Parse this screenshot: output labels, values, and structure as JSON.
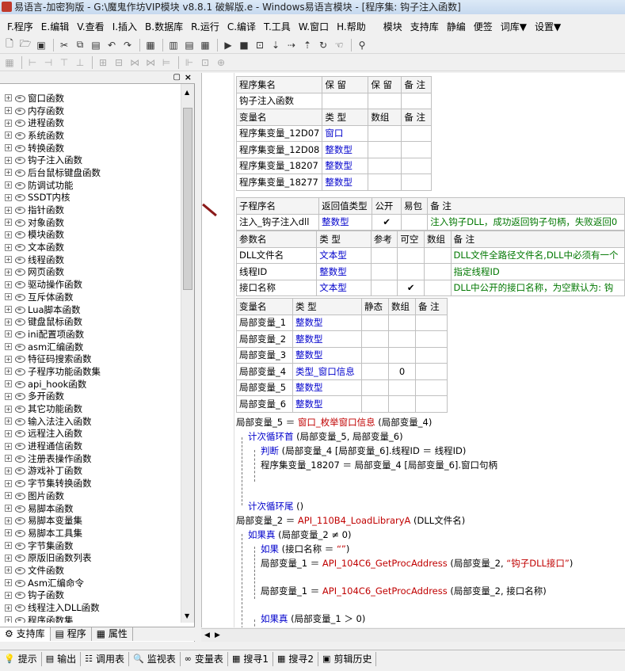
{
  "window": {
    "title": "易语言-加密狗版 - G:\\魔鬼作坊VIP模块 v8.8.1 破解版.e - Windows易语言模块 - [程序集: 钩子注入函数]"
  },
  "menu": [
    "F.程序",
    "E.编辑",
    "V.查看",
    "I.插入",
    "B.数据库",
    "R.运行",
    "C.编译",
    "T.工具",
    "W.窗口",
    "H.帮助",
    "模块",
    "支持库",
    "静编",
    "便签",
    "词库▼",
    "设置▼"
  ],
  "tree": {
    "items": [
      "窗口函数",
      "内存函数",
      "进程函数",
      "系统函数",
      "转换函数",
      "钩子注入函数",
      "后台鼠标键盘函数",
      "防调试功能",
      "SSDT内核",
      "指针函数",
      "对象函数",
      "模块函数",
      "文本函数",
      "线程函数",
      "网页函数",
      "驱动操作函数",
      "互斥体函数",
      "Lua脚本函数",
      "键盘鼠标函数",
      "ini配置项函数",
      "asm汇编函数",
      "特征码搜索函数",
      "子程序功能函数集",
      "api_hook函数",
      "多开函数",
      "其它功能函数",
      "输入法注入函数",
      "远程注入函数",
      "进程通信函数",
      "注册表操作函数",
      "游戏补丁函数",
      "字节集转换函数",
      "图片函数",
      "易脚本函数",
      "易脚本变量集",
      "易脚本工具集",
      "字节集函数",
      "原版旧函数列表",
      "文件函数",
      "Asm汇编命令",
      "钩子函数",
      "线程注入DLL函数",
      "程序函数集"
    ]
  },
  "left_tabs": [
    "支持库",
    "程序",
    "属性"
  ],
  "assembly": {
    "headers": [
      "程序集名",
      "保 留",
      "保 留",
      "备 注"
    ],
    "name": "钩子注入函数",
    "var_headers": [
      "变量名",
      "类 型",
      "数组",
      "备 注"
    ],
    "vars": [
      {
        "name": "程序集变量_12D07",
        "type": "窗口"
      },
      {
        "name": "程序集变量_12D08",
        "type": "整数型"
      },
      {
        "name": "程序集变量_18207",
        "type": "整数型"
      },
      {
        "name": "程序集变量_18277",
        "type": "整数型"
      }
    ]
  },
  "sub": {
    "headers": [
      "子程序名",
      "返回值类型",
      "公开",
      "易包",
      "备 注"
    ],
    "name": "注入_钩子注入dll",
    "ret_type": "整数型",
    "public_check": "✔",
    "remark": "注入钩子DLL，成功返回钩子句柄，失败返回0",
    "param_headers": [
      "参数名",
      "类 型",
      "参考",
      "可空",
      "数组",
      "备 注"
    ],
    "params": [
      {
        "name": "DLL文件名",
        "type": "文本型",
        "nullable": "",
        "remark": "DLL文件全路径文件名,DLL中必须有一个"
      },
      {
        "name": "线程ID",
        "type": "整数型",
        "nullable": "",
        "remark": "指定线程ID"
      },
      {
        "name": "接口名称",
        "type": "文本型",
        "nullable": "✔",
        "remark": "DLL中公开的接口名称，为空默认为: 钩"
      }
    ]
  },
  "locals": {
    "headers": [
      "变量名",
      "类 型",
      "静态",
      "数组",
      "备 注"
    ],
    "rows": [
      {
        "name": "局部变量_1",
        "type": "整数型",
        "array": ""
      },
      {
        "name": "局部变量_2",
        "type": "整数型",
        "array": ""
      },
      {
        "name": "局部变量_3",
        "type": "整数型",
        "array": ""
      },
      {
        "name": "局部变量_4",
        "type": "类型_窗口信息",
        "array": "0"
      },
      {
        "name": "局部变量_5",
        "type": "整数型",
        "array": ""
      },
      {
        "name": "局部变量_6",
        "type": "整数型",
        "array": ""
      }
    ]
  },
  "code": {
    "l1_a": "局部变量_5 ＝ ",
    "l1_fn": "窗口_枚举窗口信息",
    "l1_b": " (局部变量_4)",
    "l2_kw": "计次循环首",
    "l2_b": " (局部变量_5, 局部变量_6)",
    "l3_kw": "判断",
    "l3_b": " (局部变量_4 [局部变量_6].线程ID ＝ 线程ID)",
    "l4": "程序集变量_18207 ＝ 局部变量_4 [局部变量_6].窗口句柄",
    "l5_kw": "计次循环尾",
    "l5_b": " ()",
    "l6_a": "局部变量_2 ＝ ",
    "l6_fn": "API_110B4_LoadLibraryA",
    "l6_b": " (DLL文件名)",
    "l7_kw": "如果真",
    "l7_b": " (局部变量_2 ≠ 0)",
    "l8_kw": "如果",
    "l8_b": " (接口名称 ＝ ",
    "l8_str": "“”",
    "l8_c": ")",
    "l9_a": "局部变量_1 ＝ ",
    "l9_fn": "API_104C6_GetProcAddress",
    "l9_b": " (局部变量_2, ",
    "l9_str": "“钩子DLL接口”",
    "l9_c": ")",
    "l10_a": "局部变量_1 ＝ ",
    "l10_fn": "API_104C6_GetProcAddress",
    "l10_b": " (局部变量_2, 接口名称)",
    "l11_kw": "如果真",
    "l11_b": " (局部变量_1 ＞ 0)"
  },
  "bottom_tabs": [
    "提示",
    "输出",
    "调用表",
    "监视表",
    "变量表",
    "搜寻1",
    "搜寻2",
    "剪辑历史"
  ],
  "colors": {
    "type": "#0000cc",
    "function": "#c00000",
    "remark": "#007700"
  }
}
